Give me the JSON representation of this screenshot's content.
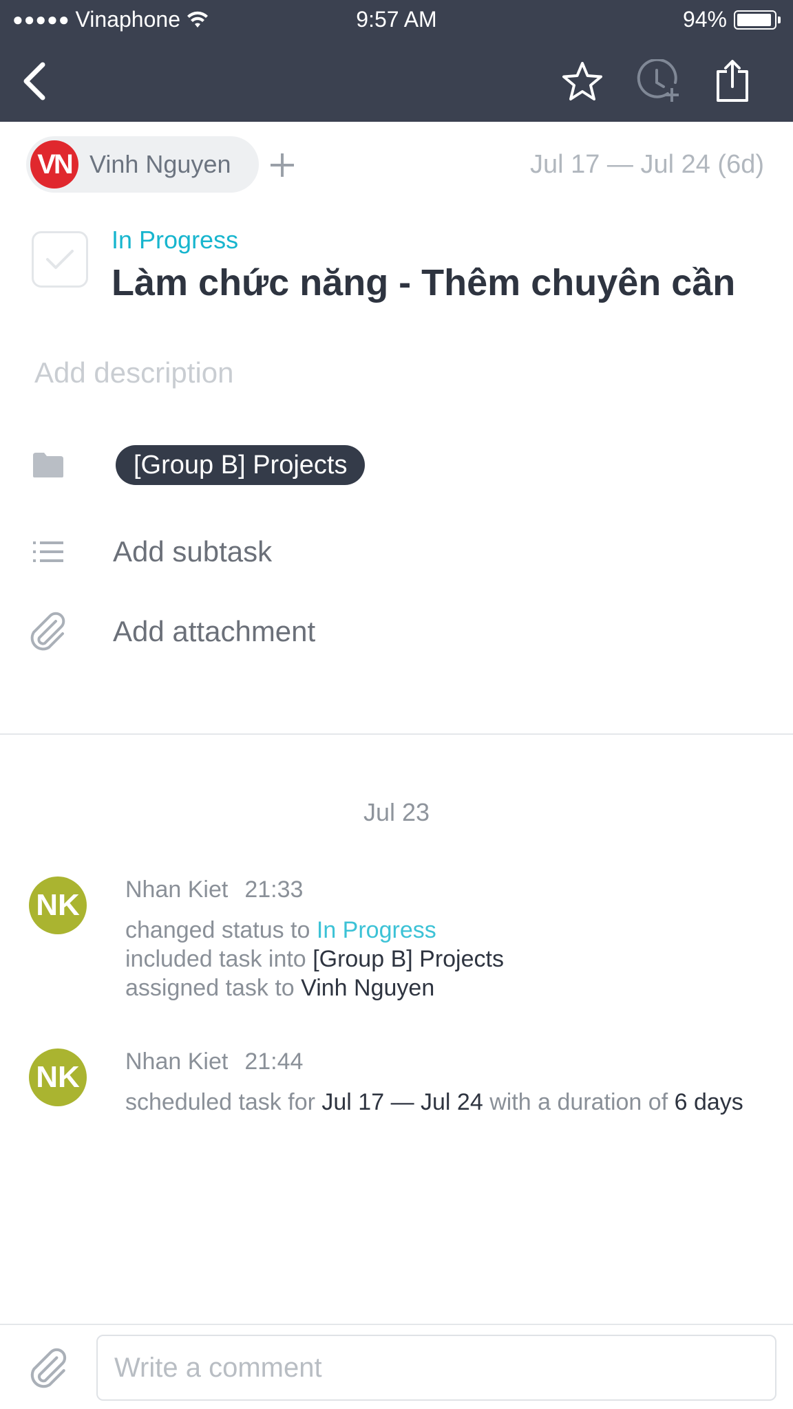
{
  "status_bar": {
    "carrier": "Vinaphone",
    "signal_dots": "●●●●●",
    "time": "9:57 AM",
    "battery": "94%",
    "battery_level": 0.94
  },
  "nav": {
    "icons": [
      "back-chevron-icon",
      "star-icon",
      "clock-plus-icon",
      "share-icon"
    ]
  },
  "assignee": {
    "initials": "VN",
    "name": "Vinh Nguyen",
    "avatar_color": "#e0282e"
  },
  "date_range": "Jul 17 — Jul 24 (6d)",
  "task": {
    "status": "In Progress",
    "title": "Làm chức năng - Thêm chuyên cần"
  },
  "description_placeholder": "Add description",
  "project": "[Group B] Projects",
  "add_subtask": "Add subtask",
  "add_attachment": "Add attachment",
  "activity": {
    "day": "Jul 23",
    "entries": [
      {
        "initials": "NK",
        "author": "Nhan Kiet",
        "time": "21:33",
        "status_prefix": "changed status to",
        "status_value": "In Progress",
        "project_prefix": "included task into",
        "project_value": "[Group B] Projects",
        "assign_prefix": "assigned task to",
        "assign_value": "Vinh Nguyen"
      },
      {
        "initials": "NK",
        "author": "Nhan Kiet",
        "time": "21:44",
        "prefix": "scheduled task for",
        "range": "Jul 17 — Jul 24",
        "middle": "with a duration of",
        "duration": "6 days"
      }
    ]
  },
  "comment": {
    "placeholder": "Write a comment"
  },
  "colors": {
    "header_bg": "#3b4150",
    "accent": "#17b5ce",
    "activity_avatar": "#aab430",
    "project_pill": "#343b49"
  }
}
